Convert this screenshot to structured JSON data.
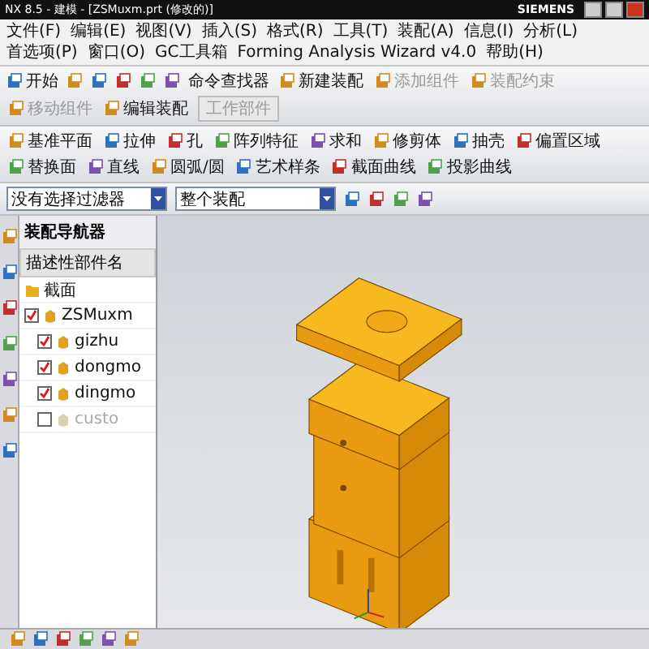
{
  "window": {
    "title": "NX 8.5 - 建模 - [ZSMuxm.prt (修改的)]",
    "brand": "SIEMENS"
  },
  "menu": [
    "文件(F)",
    "编辑(E)",
    "视图(V)",
    "插入(S)",
    "格式(R)",
    "工具(T)",
    "装配(A)",
    "信息(I)",
    "分析(L)",
    "首选项(P)",
    "窗口(O)",
    "GC工具箱",
    "Forming Analysis Wizard v4.0",
    "帮助(H)"
  ],
  "standard_toolbar": {
    "start": "开始",
    "finder": "命令查找器"
  },
  "assembly_toolbar": [
    {
      "label": "新建装配",
      "disabled": false
    },
    {
      "label": "添加组件",
      "disabled": true
    },
    {
      "label": "装配约束",
      "disabled": true
    },
    {
      "label": "移动组件",
      "disabled": true
    },
    {
      "label": "编辑装配",
      "disabled": false
    }
  ],
  "work_part": {
    "label": "工作部件",
    "disabled": true
  },
  "feature_toolbar": [
    "基准平面",
    "拉伸",
    "孔",
    "阵列特征",
    "求和",
    "修剪体",
    "抽壳",
    "偏置区域",
    "替换面",
    "直线",
    "圆弧/圆",
    "艺术样条",
    "截面曲线",
    "投影曲线"
  ],
  "filters": [
    "没有选择过滤器",
    "整个装配"
  ],
  "navigator": {
    "title": "装配导航器",
    "column": "描述性部件名",
    "tree": [
      {
        "label": "截面",
        "kind": "folder"
      },
      {
        "label": "ZSMuxm",
        "kind": "part",
        "checked": true,
        "children": [
          {
            "label": "gizhu",
            "kind": "part",
            "checked": true
          },
          {
            "label": "dongmo",
            "kind": "part",
            "checked": true
          },
          {
            "label": "dingmo",
            "kind": "part",
            "checked": true
          },
          {
            "label": "custo",
            "kind": "part",
            "checked": false
          }
        ]
      }
    ]
  }
}
